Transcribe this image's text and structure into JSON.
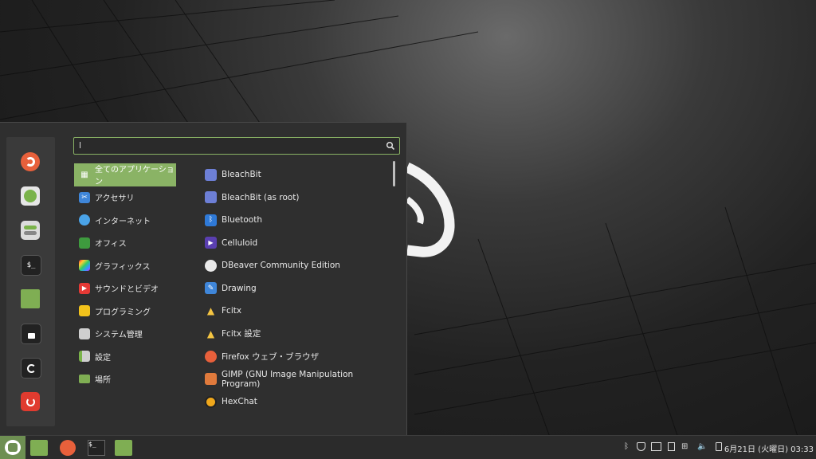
{
  "search": {
    "value": "l"
  },
  "categories": [
    {
      "label": "全てのアプリケーション",
      "icon": "grid-icon",
      "selected": true
    },
    {
      "label": "アクセサリ",
      "icon": "scissors-icon"
    },
    {
      "label": "インターネット",
      "icon": "cloud-icon"
    },
    {
      "label": "オフィス",
      "icon": "office-icon"
    },
    {
      "label": "グラフィックス",
      "icon": "graphics-icon"
    },
    {
      "label": "サウンドとビデオ",
      "icon": "play-icon"
    },
    {
      "label": "プログラミング",
      "icon": "programming-icon"
    },
    {
      "label": "システム管理",
      "icon": "system-icon"
    },
    {
      "label": "設定",
      "icon": "settings-icon"
    },
    {
      "label": "場所",
      "icon": "folder-icon"
    }
  ],
  "apps": [
    {
      "label": "BleachBit",
      "icon": "bleachbit-icon"
    },
    {
      "label": "BleachBit (as root)",
      "icon": "bleachbit-root-icon"
    },
    {
      "label": "Bluetooth",
      "icon": "bluetooth-icon"
    },
    {
      "label": "Celluloid",
      "icon": "celluloid-icon"
    },
    {
      "label": "DBeaver Community Edition",
      "icon": "dbeaver-icon"
    },
    {
      "label": "Drawing",
      "icon": "drawing-icon"
    },
    {
      "label": "Fcitx",
      "icon": "fcitx-icon"
    },
    {
      "label": "Fcitx 設定",
      "icon": "fcitx-settings-icon"
    },
    {
      "label": "Firefox ウェブ・ブラウザ",
      "icon": "firefox-icon"
    },
    {
      "label": "GIMP (GNU Image Manipulation Program)",
      "icon": "gimp-icon"
    },
    {
      "label": "HexChat",
      "icon": "hexchat-icon"
    }
  ],
  "clock": "6月21日 (火曜日) 03:33",
  "colors": {
    "accent": "#8ab365",
    "panel": "#2b2b2b",
    "menu": "#2f2f2f"
  }
}
